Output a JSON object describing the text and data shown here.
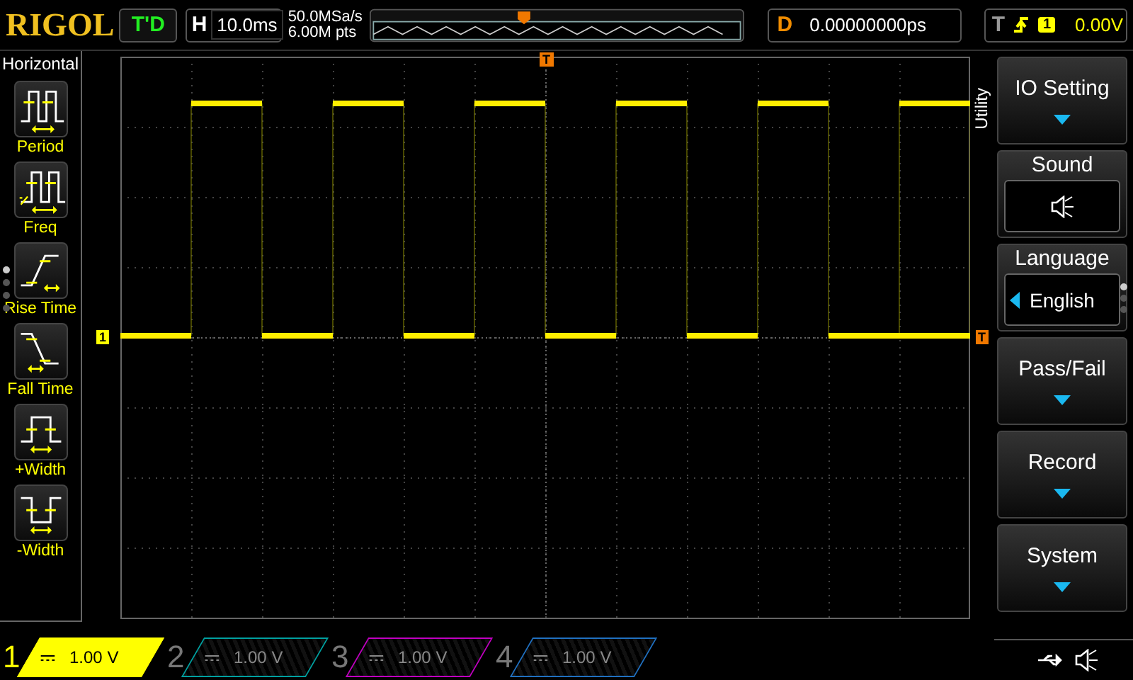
{
  "top_bar": {
    "logo": "RIGOL",
    "run_status": "T'D",
    "horizontal": {
      "label": "H",
      "timebase": "10.0ms"
    },
    "sample_rate": "50.0MSa/s",
    "memory_depth": "6.00M pts",
    "delay": {
      "label": "D",
      "value": "0.00000000ps"
    },
    "trigger": {
      "label": "T",
      "source": "1",
      "level": "0.00V"
    }
  },
  "markers": {
    "channel": "1",
    "trigger_level": "T",
    "trigger_position": "T"
  },
  "left_menu": {
    "title": "Horizontal",
    "items": [
      {
        "kind": "period",
        "label": "Period"
      },
      {
        "kind": "freq",
        "label": "Freq"
      },
      {
        "kind": "rise",
        "label": "Rise Time"
      },
      {
        "kind": "fall",
        "label": "Fall Time"
      },
      {
        "kind": "pwidth",
        "label": "+Width"
      },
      {
        "kind": "nwidth",
        "label": "-Width"
      }
    ],
    "pages": [
      {
        "selected": true
      },
      {
        "selected": false
      },
      {
        "selected": false
      },
      {
        "selected": false
      }
    ]
  },
  "right_menu": {
    "title": "Utility",
    "items": [
      {
        "kind": "submenu",
        "label": "IO Setting"
      },
      {
        "kind": "icon",
        "label": "Sound",
        "on": true
      },
      {
        "kind": "value",
        "label": "Language",
        "value": "English"
      },
      {
        "kind": "submenu",
        "label": "Pass/Fail"
      },
      {
        "kind": "submenu",
        "label": "Record"
      },
      {
        "kind": "submenu",
        "label": "System"
      }
    ],
    "pages": [
      {
        "selected": true
      },
      {
        "selected": false
      },
      {
        "selected": false
      }
    ]
  },
  "channels": [
    {
      "number": "1",
      "scale": "1.00 V",
      "on": true,
      "color": "#ffff00"
    },
    {
      "number": "2",
      "scale": "1.00 V",
      "on": false,
      "color": "#00a0a0"
    },
    {
      "number": "3",
      "scale": "1.00 V",
      "on": false,
      "color": "#c000c0"
    },
    {
      "number": "4",
      "scale": "1.00 V",
      "on": false,
      "color": "#2070c0"
    }
  ]
}
